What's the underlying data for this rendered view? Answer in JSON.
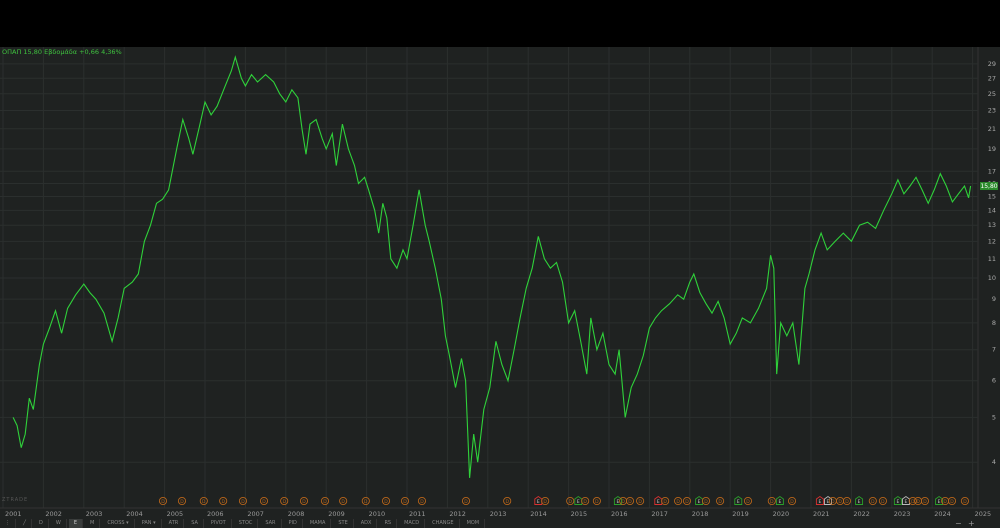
{
  "header": {
    "symbol": "ΟΠΑΠ",
    "price": "15,80",
    "period": "Εβδομάδα",
    "change": "+0,66",
    "change_pct": "4,36%"
  },
  "watermark": "ZTRADE",
  "toolbar": [
    "⋮",
    "╱",
    "D",
    "W",
    "E",
    "M",
    "CROSS ▾",
    "PAN ▾",
    "ATR",
    "SA",
    "PIVOT",
    "STOC",
    "SAR",
    "PID",
    "MAMA",
    "STE",
    "ADX",
    "RS",
    "MACD",
    "CHANGE",
    "MOM"
  ],
  "colors": {
    "line": "#2fd13a",
    "bg": "#1f2221",
    "grid": "#2b2f2e",
    "dividend": "#b8651a",
    "e_red": "#d83030",
    "e_green": "#2aa02a",
    "e_white": "#bbbbbb"
  },
  "chart_data": {
    "type": "line",
    "title": "ΟΠΑΠ 15,80 Εβδομάδα +0,66 4,36%",
    "yscale": "log",
    "ylim": [
      3.6,
      32
    ],
    "xlim": [
      2001,
      2025.1
    ],
    "yticks": [
      29,
      27,
      25,
      23,
      21,
      19,
      17,
      16,
      15,
      14,
      13,
      12,
      11,
      10,
      9,
      8,
      7,
      6,
      5,
      4
    ],
    "xticks": [
      2001,
      2002,
      2003,
      2004,
      2005,
      2006,
      2007,
      2008,
      2009,
      2010,
      2011,
      2012,
      2013,
      2014,
      2015,
      2016,
      2017,
      2018,
      2019,
      2020,
      2021,
      2022,
      2023,
      2024,
      2025
    ],
    "last_price_label": "15,80",
    "series": [
      {
        "name": "ΟΠΑΠ",
        "points": [
          [
            2001.25,
            5.0
          ],
          [
            2001.35,
            4.8
          ],
          [
            2001.45,
            4.3
          ],
          [
            2001.55,
            4.6
          ],
          [
            2001.65,
            5.5
          ],
          [
            2001.75,
            5.2
          ],
          [
            2001.9,
            6.5
          ],
          [
            2002.0,
            7.2
          ],
          [
            2002.15,
            7.8
          ],
          [
            2002.3,
            8.5
          ],
          [
            2002.45,
            7.6
          ],
          [
            2002.6,
            8.6
          ],
          [
            2002.8,
            9.2
          ],
          [
            2003.0,
            9.7
          ],
          [
            2003.15,
            9.3
          ],
          [
            2003.3,
            9.0
          ],
          [
            2003.5,
            8.4
          ],
          [
            2003.7,
            7.3
          ],
          [
            2003.85,
            8.2
          ],
          [
            2004.0,
            9.5
          ],
          [
            2004.2,
            9.8
          ],
          [
            2004.35,
            10.2
          ],
          [
            2004.5,
            12.0
          ],
          [
            2004.65,
            13.0
          ],
          [
            2004.8,
            14.5
          ],
          [
            2004.95,
            14.8
          ],
          [
            2005.1,
            15.5
          ],
          [
            2005.3,
            19.0
          ],
          [
            2005.45,
            22.0
          ],
          [
            2005.6,
            20.0
          ],
          [
            2005.7,
            18.5
          ],
          [
            2005.85,
            21.0
          ],
          [
            2006.0,
            24.0
          ],
          [
            2006.15,
            22.5
          ],
          [
            2006.3,
            23.5
          ],
          [
            2006.5,
            26.0
          ],
          [
            2006.65,
            28.0
          ],
          [
            2006.75,
            30.0
          ],
          [
            2006.9,
            27.0
          ],
          [
            2007.0,
            26.0
          ],
          [
            2007.15,
            27.5
          ],
          [
            2007.3,
            26.5
          ],
          [
            2007.5,
            27.5
          ],
          [
            2007.7,
            26.5
          ],
          [
            2007.85,
            25.0
          ],
          [
            2008.0,
            24.0
          ],
          [
            2008.15,
            25.5
          ],
          [
            2008.3,
            24.5
          ],
          [
            2008.4,
            21.0
          ],
          [
            2008.5,
            18.5
          ],
          [
            2008.6,
            21.5
          ],
          [
            2008.75,
            22.0
          ],
          [
            2008.9,
            20.0
          ],
          [
            2009.0,
            19.0
          ],
          [
            2009.15,
            20.5
          ],
          [
            2009.25,
            17.5
          ],
          [
            2009.4,
            21.5
          ],
          [
            2009.55,
            19.0
          ],
          [
            2009.7,
            17.5
          ],
          [
            2009.8,
            16.0
          ],
          [
            2009.95,
            16.5
          ],
          [
            2010.05,
            15.5
          ],
          [
            2010.2,
            14.0
          ],
          [
            2010.3,
            12.5
          ],
          [
            2010.4,
            14.5
          ],
          [
            2010.5,
            13.5
          ],
          [
            2010.6,
            11.0
          ],
          [
            2010.75,
            10.5
          ],
          [
            2010.9,
            11.5
          ],
          [
            2011.0,
            11.0
          ],
          [
            2011.15,
            13.0
          ],
          [
            2011.3,
            15.5
          ],
          [
            2011.45,
            13.0
          ],
          [
            2011.55,
            12.0
          ],
          [
            2011.7,
            10.5
          ],
          [
            2011.85,
            9.0
          ],
          [
            2011.95,
            7.5
          ],
          [
            2012.05,
            6.8
          ],
          [
            2012.2,
            5.8
          ],
          [
            2012.35,
            6.7
          ],
          [
            2012.45,
            6.0
          ],
          [
            2012.55,
            3.7
          ],
          [
            2012.65,
            4.6
          ],
          [
            2012.75,
            4.0
          ],
          [
            2012.9,
            5.2
          ],
          [
            2013.05,
            5.8
          ],
          [
            2013.2,
            7.3
          ],
          [
            2013.35,
            6.5
          ],
          [
            2013.5,
            6.0
          ],
          [
            2013.65,
            7.0
          ],
          [
            2013.8,
            8.2
          ],
          [
            2013.95,
            9.5
          ],
          [
            2014.1,
            10.5
          ],
          [
            2014.25,
            12.3
          ],
          [
            2014.4,
            11.0
          ],
          [
            2014.55,
            10.5
          ],
          [
            2014.7,
            10.8
          ],
          [
            2014.85,
            9.8
          ],
          [
            2015.0,
            8.0
          ],
          [
            2015.15,
            8.5
          ],
          [
            2015.3,
            7.3
          ],
          [
            2015.45,
            6.2
          ],
          [
            2015.55,
            8.2
          ],
          [
            2015.7,
            7.0
          ],
          [
            2015.85,
            7.6
          ],
          [
            2016.0,
            6.5
          ],
          [
            2016.15,
            6.2
          ],
          [
            2016.25,
            7.0
          ],
          [
            2016.4,
            5.0
          ],
          [
            2016.55,
            5.8
          ],
          [
            2016.7,
            6.2
          ],
          [
            2016.85,
            6.8
          ],
          [
            2017.0,
            7.8
          ],
          [
            2017.15,
            8.2
          ],
          [
            2017.3,
            8.5
          ],
          [
            2017.5,
            8.8
          ],
          [
            2017.7,
            9.2
          ],
          [
            2017.85,
            9.0
          ],
          [
            2018.0,
            9.8
          ],
          [
            2018.1,
            10.2
          ],
          [
            2018.25,
            9.3
          ],
          [
            2018.4,
            8.8
          ],
          [
            2018.55,
            8.4
          ],
          [
            2018.7,
            8.9
          ],
          [
            2018.85,
            8.2
          ],
          [
            2019.0,
            7.2
          ],
          [
            2019.15,
            7.6
          ],
          [
            2019.3,
            8.2
          ],
          [
            2019.5,
            8.0
          ],
          [
            2019.7,
            8.6
          ],
          [
            2019.9,
            9.5
          ],
          [
            2020.0,
            11.2
          ],
          [
            2020.08,
            10.5
          ],
          [
            2020.15,
            6.2
          ],
          [
            2020.25,
            8.0
          ],
          [
            2020.4,
            7.5
          ],
          [
            2020.55,
            8.0
          ],
          [
            2020.7,
            6.5
          ],
          [
            2020.85,
            9.5
          ],
          [
            2020.95,
            10.2
          ],
          [
            2021.1,
            11.5
          ],
          [
            2021.25,
            12.5
          ],
          [
            2021.4,
            11.5
          ],
          [
            2021.6,
            12.0
          ],
          [
            2021.8,
            12.5
          ],
          [
            2022.0,
            12.0
          ],
          [
            2022.2,
            13.0
          ],
          [
            2022.4,
            13.2
          ],
          [
            2022.6,
            12.8
          ],
          [
            2022.8,
            14.0
          ],
          [
            2023.0,
            15.2
          ],
          [
            2023.15,
            16.3
          ],
          [
            2023.3,
            15.2
          ],
          [
            2023.45,
            15.8
          ],
          [
            2023.6,
            16.5
          ],
          [
            2023.75,
            15.5
          ],
          [
            2023.9,
            14.5
          ],
          [
            2024.05,
            15.5
          ],
          [
            2024.2,
            16.8
          ],
          [
            2024.35,
            15.8
          ],
          [
            2024.5,
            14.6
          ],
          [
            2024.65,
            15.2
          ],
          [
            2024.8,
            15.8
          ],
          [
            2024.9,
            14.9
          ],
          [
            2024.95,
            15.8
          ]
        ]
      }
    ],
    "events": [
      {
        "year": 2004.96,
        "type": "D",
        "color": "dividend"
      },
      {
        "year": 2005.43,
        "type": "D",
        "color": "dividend"
      },
      {
        "year": 2005.97,
        "type": "D",
        "color": "dividend"
      },
      {
        "year": 2006.45,
        "type": "D",
        "color": "dividend"
      },
      {
        "year": 2006.94,
        "type": "D",
        "color": "dividend"
      },
      {
        "year": 2007.46,
        "type": "D",
        "color": "dividend"
      },
      {
        "year": 2007.96,
        "type": "D",
        "color": "dividend"
      },
      {
        "year": 2008.45,
        "type": "D",
        "color": "dividend"
      },
      {
        "year": 2008.97,
        "type": "D",
        "color": "dividend"
      },
      {
        "year": 2009.42,
        "type": "D",
        "color": "dividend"
      },
      {
        "year": 2009.98,
        "type": "D",
        "color": "dividend"
      },
      {
        "year": 2010.48,
        "type": "D",
        "color": "dividend"
      },
      {
        "year": 2010.95,
        "type": "D",
        "color": "dividend"
      },
      {
        "year": 2011.37,
        "type": "D",
        "color": "dividend"
      },
      {
        "year": 2012.46,
        "type": "D",
        "color": "dividend"
      },
      {
        "year": 2013.48,
        "type": "D",
        "color": "dividend"
      },
      {
        "year": 2014.25,
        "type": "E",
        "color": "e_red"
      },
      {
        "year": 2014.42,
        "type": "D",
        "color": "dividend"
      },
      {
        "year": 2015.04,
        "type": "D",
        "color": "dividend"
      },
      {
        "year": 2015.24,
        "type": "E",
        "color": "e_green"
      },
      {
        "year": 2015.41,
        "type": "D",
        "color": "dividend"
      },
      {
        "year": 2015.7,
        "type": "D",
        "color": "dividend"
      },
      {
        "year": 2016.22,
        "type": "E",
        "color": "e_green"
      },
      {
        "year": 2016.35,
        "type": "D",
        "color": "dividend"
      },
      {
        "year": 2016.52,
        "type": "D",
        "color": "dividend"
      },
      {
        "year": 2016.77,
        "type": "D",
        "color": "dividend"
      },
      {
        "year": 2017.22,
        "type": "E",
        "color": "e_red"
      },
      {
        "year": 2017.39,
        "type": "D",
        "color": "dividend"
      },
      {
        "year": 2017.71,
        "type": "D",
        "color": "dividend"
      },
      {
        "year": 2017.93,
        "type": "D",
        "color": "dividend"
      },
      {
        "year": 2018.23,
        "type": "E",
        "color": "e_green"
      },
      {
        "year": 2018.4,
        "type": "D",
        "color": "dividend"
      },
      {
        "year": 2018.75,
        "type": "D",
        "color": "dividend"
      },
      {
        "year": 2019.2,
        "type": "E",
        "color": "e_green"
      },
      {
        "year": 2019.44,
        "type": "D",
        "color": "dividend"
      },
      {
        "year": 2020.03,
        "type": "D",
        "color": "dividend"
      },
      {
        "year": 2020.23,
        "type": "E",
        "color": "e_green"
      },
      {
        "year": 2020.53,
        "type": "D",
        "color": "dividend"
      },
      {
        "year": 2021.22,
        "type": "E",
        "color": "e_red"
      },
      {
        "year": 2021.42,
        "type": "E",
        "color": "e_white"
      },
      {
        "year": 2021.54,
        "type": "D",
        "color": "dividend"
      },
      {
        "year": 2021.72,
        "type": "D",
        "color": "dividend"
      },
      {
        "year": 2021.89,
        "type": "D",
        "color": "dividend"
      },
      {
        "year": 2022.19,
        "type": "E",
        "color": "e_green"
      },
      {
        "year": 2022.53,
        "type": "D",
        "color": "dividend"
      },
      {
        "year": 2022.78,
        "type": "D",
        "color": "dividend"
      },
      {
        "year": 2023.15,
        "type": "E",
        "color": "e_green"
      },
      {
        "year": 2023.35,
        "type": "E",
        "color": "e_white"
      },
      {
        "year": 2023.52,
        "type": "D",
        "color": "dividend"
      },
      {
        "year": 2023.65,
        "type": "D",
        "color": "dividend"
      },
      {
        "year": 2023.82,
        "type": "D",
        "color": "dividend"
      },
      {
        "year": 2024.17,
        "type": "E",
        "color": "e_green"
      },
      {
        "year": 2024.32,
        "type": "D",
        "color": "dividend"
      },
      {
        "year": 2024.49,
        "type": "D",
        "color": "dividend"
      },
      {
        "year": 2024.81,
        "type": "D",
        "color": "dividend"
      }
    ]
  }
}
